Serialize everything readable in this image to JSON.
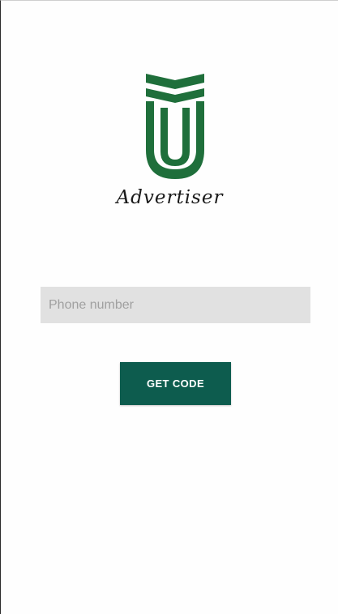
{
  "brand": {
    "logo_icon": "advertiser-logo-icon",
    "name": "Advertiser",
    "color": "#1f6f3b"
  },
  "login": {
    "phone_placeholder": "Phone number",
    "phone_value": "",
    "get_code_label": "GET CODE",
    "button_color": "#0d5c4e"
  }
}
